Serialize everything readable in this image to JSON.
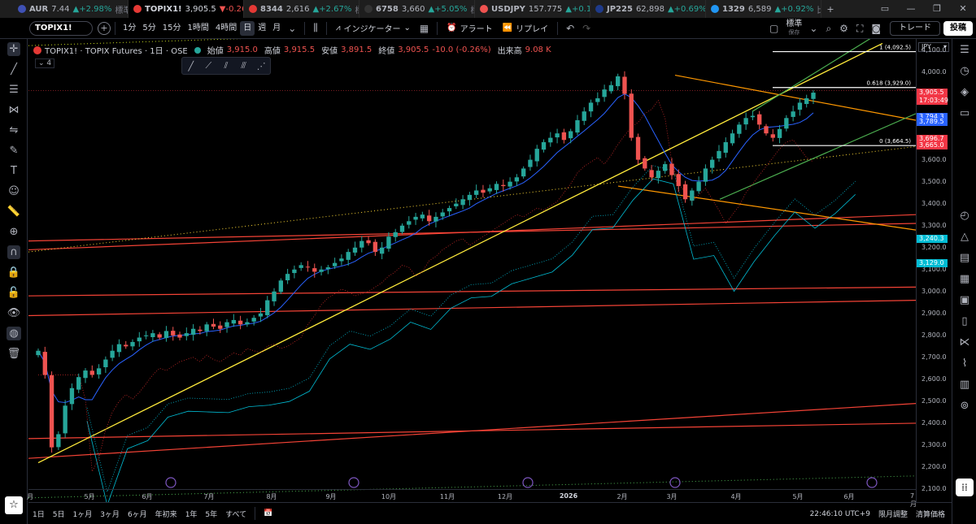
{
  "tabs": [
    {
      "symbol": "AUR",
      "price": "7.44",
      "change": "▲+2.98%",
      "dir": "up",
      "tag": "標準",
      "color": "#3f51b5"
    },
    {
      "symbol": "TOPIX1!",
      "price": "3,905.5",
      "change": "▼-0.26%",
      "dir": "dn",
      "tag": "",
      "color": "#e53935"
    },
    {
      "symbol": "8344",
      "price": "2,616",
      "change": "▲+2.67%",
      "dir": "up",
      "tag": "標準",
      "color": "#e53935"
    },
    {
      "symbol": "6758",
      "price": "3,660",
      "change": "▲+5.05%",
      "dir": "up",
      "tag": "標準",
      "color": "#333"
    },
    {
      "symbol": "USDJPY",
      "price": "157.775",
      "change": "▲+0.1%",
      "dir": "up",
      "tag": "",
      "color": "#ef5350"
    },
    {
      "symbol": "JP225",
      "price": "62,898",
      "change": "▲+0.69%",
      "dir": "up",
      "tag": "",
      "color": "#1e3a8a"
    },
    {
      "symbol": "1329",
      "price": "6,589",
      "change": "▲+0.92%",
      "dir": "up",
      "tag": "比",
      "color": "#2196f3"
    }
  ],
  "toolbar": {
    "symbol": "TOPIX1!",
    "timeframes": [
      "1分",
      "5分",
      "15分",
      "1時間",
      "4時間",
      "日",
      "週",
      "月"
    ],
    "selected_tf": "日",
    "indicators": "インジケーター",
    "alert": "アラート",
    "replay": "リプレイ",
    "layout_name": "標準",
    "layout_sub": "保存",
    "trade": "トレード",
    "post": "投稿"
  },
  "legend": {
    "title": "TOPIX1! · TOPIX Futures · 1日 · OSE",
    "open_label": "始値",
    "open": "3,915.0",
    "high_label": "高値",
    "high": "3,915.5",
    "low_label": "安値",
    "low": "3,891.5",
    "close_label": "終値",
    "close": "3,905.5",
    "change": "-10.0 (-0.26%)",
    "vol_label": "出来高",
    "vol": "9.08 K",
    "indicator_count": "4"
  },
  "price_scale": {
    "currency": "JPY",
    "ticks": [
      "4,100.0",
      "4,000.0",
      "3,900.0",
      "3,800.0",
      "3,700.0",
      "3,600.0",
      "3,500.0",
      "3,400.0",
      "3,300.0",
      "3,200.0",
      "3,100.0",
      "3,000.0",
      "2,900.0",
      "2,800.0",
      "2,700.0",
      "2,600.0",
      "2,500.0",
      "2,400.0",
      "2,300.0",
      "2,200.0",
      "2,100.0"
    ],
    "labels": [
      {
        "text": "3,905.5",
        "sub": "17:03:49",
        "color": "#f23645",
        "price": 3905.5
      },
      {
        "text": "3,794.3",
        "color": "#2962ff",
        "price": 3794.3
      },
      {
        "text": "3,789.5",
        "color": "#2962ff",
        "price": 3774
      },
      {
        "text": "3,696.7",
        "color": "#f23645",
        "price": 3696.7
      },
      {
        "text": "3,665.0",
        "color": "#f23645",
        "price": 3665
      },
      {
        "text": "3,240.3",
        "color": "#00bcd4",
        "price": 3240.3
      },
      {
        "text": "3,129.0",
        "color": "#00bcd4",
        "price": 3129
      }
    ]
  },
  "fib": [
    {
      "label": "1 (4,092.5)",
      "price": 4092.5
    },
    {
      "label": "0.618 (3,929.0)",
      "price": 3929
    },
    {
      "label": "0 (3,664.5)",
      "price": 3664.5
    }
  ],
  "time_axis": {
    "ticks": [
      "月",
      "5月",
      "6月",
      "7月",
      "8月",
      "9月",
      "10月",
      "11月",
      "12月",
      "2026",
      "2月",
      "3月",
      "4月",
      "5月",
      "6月",
      "7月"
    ]
  },
  "bottom": {
    "ranges": [
      "1日",
      "5日",
      "1ヶ月",
      "3ヶ月",
      "6ヶ月",
      "年初来",
      "1年",
      "5年",
      "すべて"
    ],
    "clock": "22:46:10 UTC+9",
    "adjust": "限月調整",
    "settle": "清算価格"
  },
  "chart_data": {
    "type": "candlestick",
    "y_range": [
      2100,
      4150
    ],
    "closes": [
      2730,
      2620,
      2290,
      2350,
      2480,
      2560,
      2610,
      2640,
      2620,
      2650,
      2690,
      2730,
      2760,
      2750,
      2770,
      2790,
      2800,
      2810,
      2790,
      2820,
      2800,
      2790,
      2810,
      2830,
      2820,
      2850,
      2840,
      2830,
      2860,
      2870,
      2850,
      2860,
      2880,
      2900,
      2960,
      3000,
      3050,
      3080,
      3100,
      3120,
      3110,
      3090,
      3100,
      3110,
      3130,
      3150,
      3180,
      3200,
      3230,
      3220,
      3180,
      3200,
      3250,
      3270,
      3300,
      3320,
      3340,
      3350,
      3320,
      3340,
      3360,
      3380,
      3400,
      3420,
      3440,
      3460,
      3450,
      3470,
      3490,
      3480,
      3500,
      3520,
      3560,
      3600,
      3650,
      3680,
      3700,
      3720,
      3690,
      3730,
      3780,
      3820,
      3860,
      3880,
      3920,
      3940,
      3980,
      3900,
      3700,
      3600,
      3560,
      3520,
      3550,
      3580,
      3530,
      3480,
      3420,
      3460,
      3500,
      3560,
      3600,
      3640,
      3680,
      3720,
      3760,
      3790,
      3800,
      3760,
      3720,
      3700,
      3740,
      3790,
      3820,
      3860,
      3880,
      3905.5
    ]
  }
}
